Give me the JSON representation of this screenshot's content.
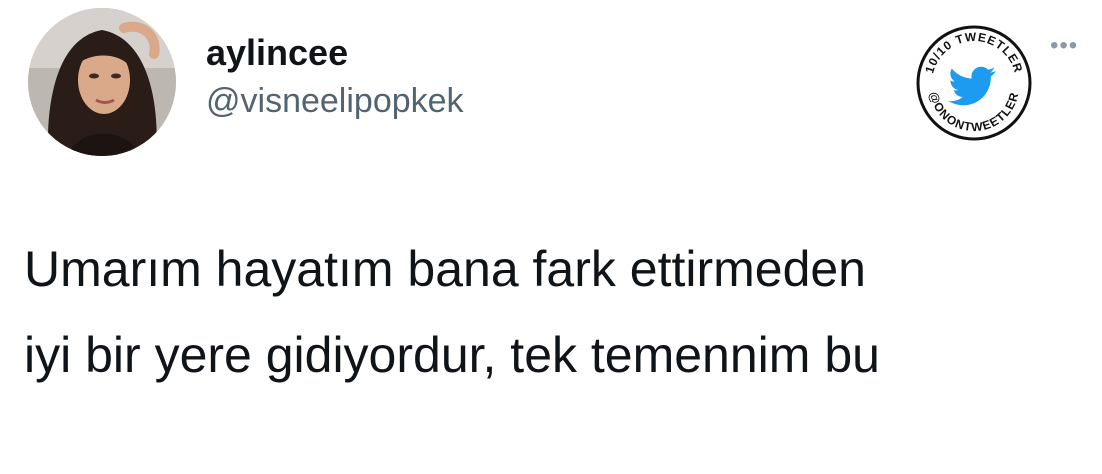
{
  "tweet": {
    "author": {
      "display_name": "aylincee",
      "handle": "@visneelipopkek",
      "avatar_icon": "profile-photo"
    },
    "text": "Umarım hayatım bana fark ettirmeden\niyi bir yere gidiyordur, tek temennim bu",
    "more_icon": "more-dots-icon"
  },
  "badge": {
    "top_text": "10/10 TWEETLER",
    "bottom_text": "@ONONTWEETLER",
    "icon": "twitter-bird-icon",
    "bird_color": "#1d9bf0"
  }
}
